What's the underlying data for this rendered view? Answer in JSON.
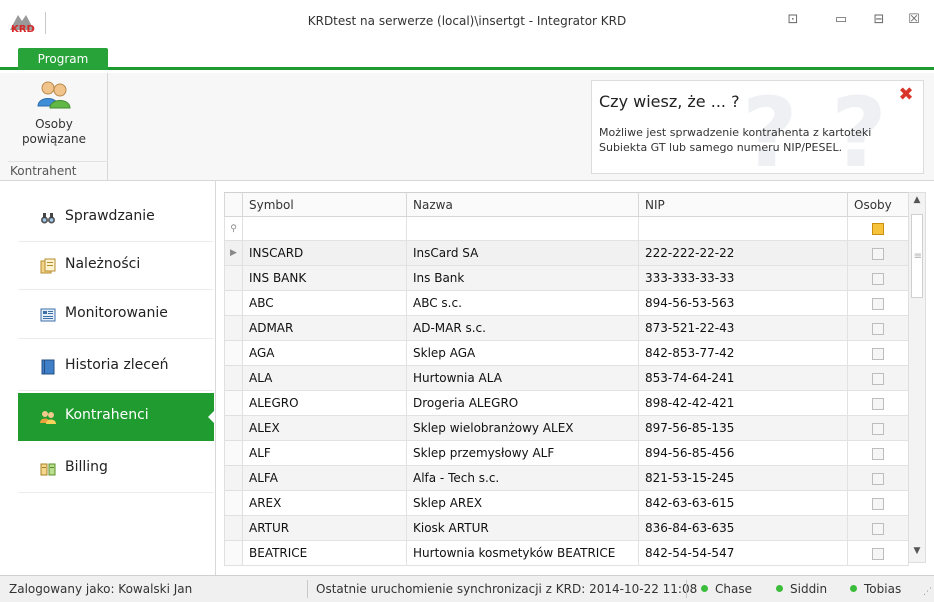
{
  "window": {
    "title": "KRDtest na serwerze (local)\\insertgt - Integrator KRD",
    "controls": [
      "restore-icon",
      "minimize-icon",
      "maximize-icon",
      "close-icon"
    ],
    "control_glyphs": {
      "layout": "⊡",
      "minimize": "▭",
      "maximize": "⊟",
      "close": "☒"
    }
  },
  "ribbon": {
    "tab_label": "Program",
    "button_label_line1": "Osoby",
    "button_label_line2": "powiązane",
    "group_label": "Kontrahent",
    "tip": {
      "title": "Czy wiesz, że ... ?",
      "text": "Możliwe jest sprwadzenie kontrahenta z kartoteki Subiekta GT lub samego numeru NIP/PESEL.",
      "close_glyph": "✖"
    }
  },
  "nav": {
    "items": [
      {
        "label": "Sprawdzanie",
        "icon": "binoculars-icon"
      },
      {
        "label": "Należności",
        "icon": "documents-icon"
      },
      {
        "label": "Monitorowanie",
        "icon": "monitor-icon"
      },
      {
        "label": "Historia zleceń",
        "icon": "book-icon"
      },
      {
        "label": "Kontrahenci",
        "icon": "people-icon"
      },
      {
        "label": "Billing",
        "icon": "billing-icon"
      }
    ],
    "active": "Kontrahenci"
  },
  "grid": {
    "columns": [
      "Symbol",
      "Nazwa",
      "NIP",
      "Osoby"
    ],
    "filter_glyph": "⚲",
    "row_indicator": "▶",
    "rows": [
      [
        "INSCARD",
        "InsCard SA",
        "222-222-22-22"
      ],
      [
        "INS BANK",
        "Ins Bank",
        "333-333-33-33"
      ],
      [
        "ABC",
        "ABC s.c.",
        "894-56-53-563"
      ],
      [
        "ADMAR",
        "AD-MAR s.c.",
        "873-521-22-43"
      ],
      [
        "AGA",
        "Sklep AGA",
        "842-853-77-42"
      ],
      [
        "ALA",
        "Hurtownia ALA",
        "853-74-64-241"
      ],
      [
        "ALEGRO",
        "Drogeria ALEGRO",
        "898-42-42-421"
      ],
      [
        "ALEX",
        "Sklep wielobranżowy  ALEX",
        "897-56-85-135"
      ],
      [
        "ALF",
        "Sklep przemysłowy ALF",
        "894-56-85-456"
      ],
      [
        "ALFA",
        "Alfa - Tech s.c.",
        "821-53-15-245"
      ],
      [
        "AREX",
        "Sklep AREX",
        "842-63-63-615"
      ],
      [
        "ARTUR",
        "Kiosk ARTUR",
        "836-84-63-635"
      ],
      [
        "BEATRICE",
        "Hurtownia kosmetyków BEATRICE",
        "842-54-54-547"
      ]
    ],
    "scroll_up": "▲",
    "scroll_down": "▼"
  },
  "status": {
    "login": "Zalogowany jako: Kowalski Jan",
    "sync": "Ostatnie uruchomienie synchronizacji z KRD: 2014-10-22 11:08",
    "nodes": [
      "Chase",
      "Siddin",
      "Tobias"
    ],
    "node_color": "#3bbd3b"
  },
  "colors": {
    "accent": "#1f9b2f",
    "tab": "#27a339",
    "tip_close": "#d9362b"
  }
}
